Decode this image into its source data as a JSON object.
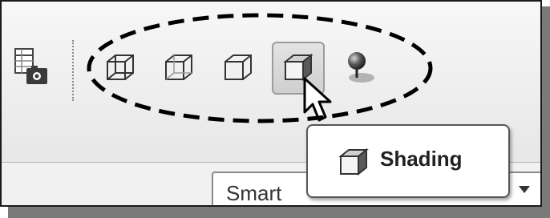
{
  "toolbar": {
    "tools": [
      {
        "icon": "report-camera-icon"
      },
      {
        "icon": "wireframe-hidden-lines-icon"
      },
      {
        "icon": "wireframe-no-hidden-icon"
      },
      {
        "icon": "hidden-line-removal-icon"
      },
      {
        "icon": "shading-cube-icon",
        "active": true
      },
      {
        "icon": "lighting-sphere-icon"
      }
    ]
  },
  "tooltip": {
    "label": "Shading"
  },
  "selector": {
    "value": "Smart"
  },
  "colors": {
    "background": "#ececec",
    "active_button": "#d6d6d6",
    "annotation": "#000000"
  }
}
